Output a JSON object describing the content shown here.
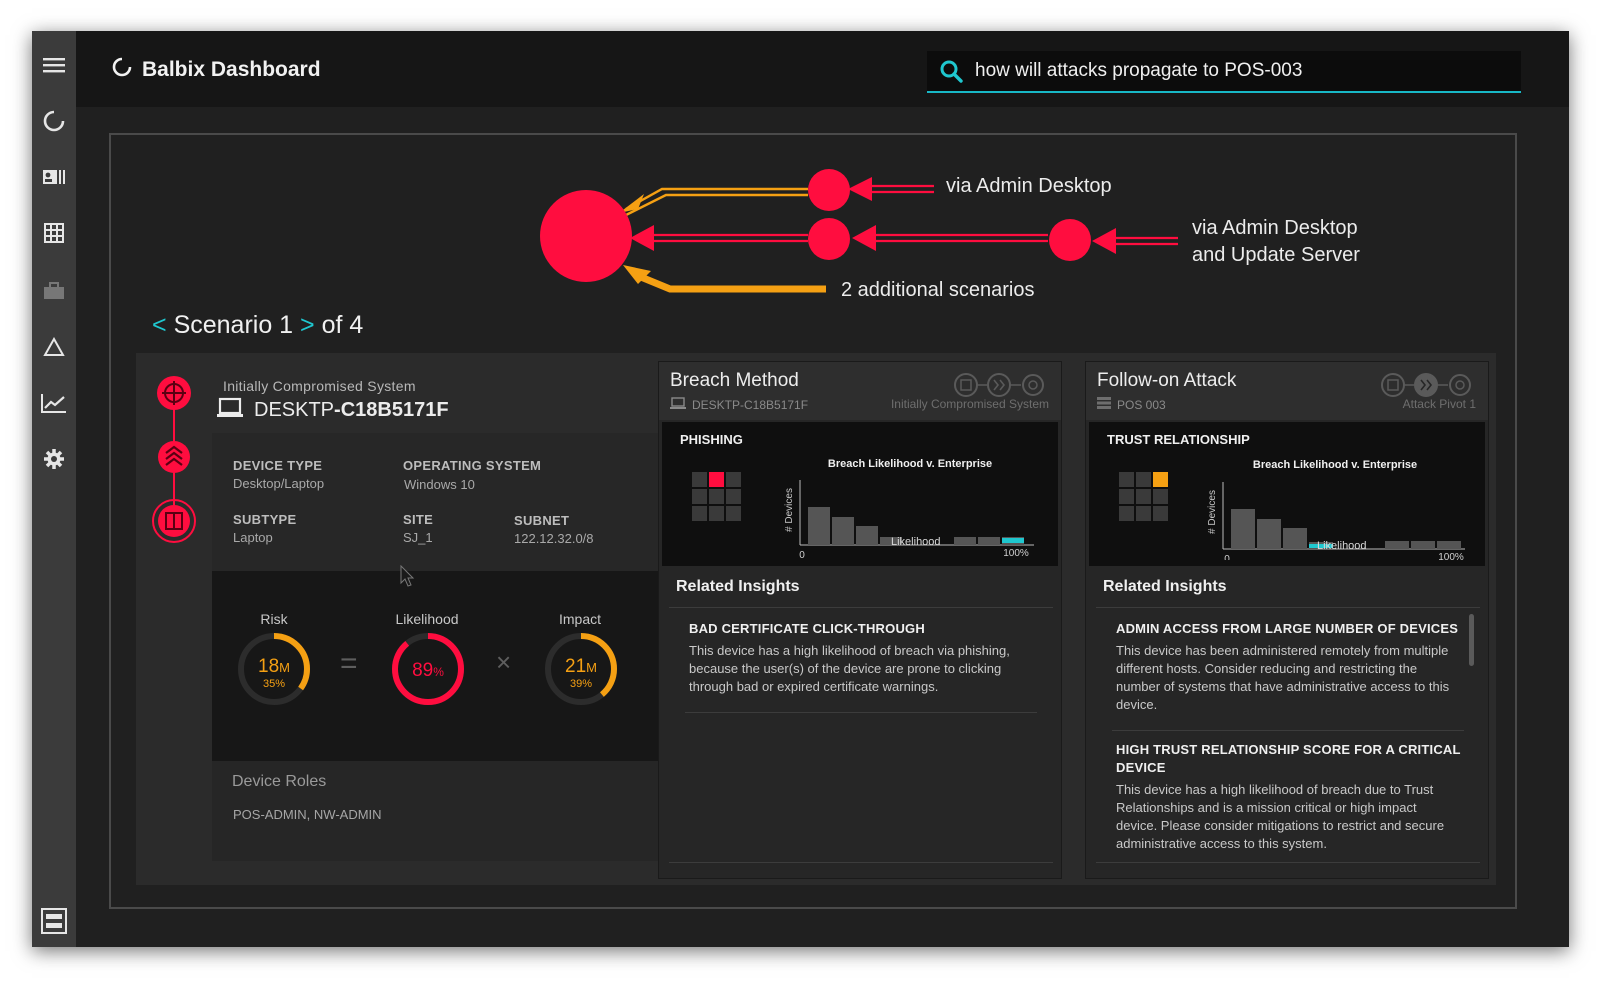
{
  "app": {
    "title": "Balbix Dashboard"
  },
  "search": {
    "value": "how will attacks propagate to POS-003"
  },
  "sidebar": {
    "icons": [
      "menu-icon",
      "loader-icon",
      "id-card-icon",
      "grid-icon",
      "briefcase-icon",
      "warning-triangle-icon",
      "trend-chart-icon",
      "gear-icon",
      "collapse-icon"
    ]
  },
  "graph": {
    "paths": [
      {
        "label": "via Admin Desktop"
      },
      {
        "label_line1": "via Admin Desktop",
        "label_line2": "and Update Server"
      },
      {
        "label": "2 additional scenarios"
      }
    ],
    "colors": {
      "node": "#ff0d3f",
      "orange": "#f5a013"
    }
  },
  "scenario": {
    "prev": "<",
    "label": "Scenario 1",
    "next": ">",
    "of": "of 4"
  },
  "device": {
    "header_label": "Initially Compromised System",
    "name_prefix": "DESKTP",
    "name_suffix": "-C18B5171F",
    "device_type_label": "DEVICE TYPE",
    "device_type": "Desktop/Laptop",
    "os_label": "OPERATING SYSTEM",
    "os": "Windows 10",
    "subtype_label": "SUBTYPE",
    "subtype": "Laptop",
    "site_label": "SITE",
    "site": "SJ_1",
    "subnet_label": "SUBNET",
    "subnet": "122.12.32.0/8"
  },
  "metrics": {
    "risk": {
      "label": "Risk",
      "value": "18",
      "unit": "M",
      "percent": "35",
      "pct_sign": "%",
      "fraction": 0.35
    },
    "equals": "=",
    "likelihood": {
      "label": "Likelihood",
      "value": "89",
      "pct_sign": "%",
      "fraction": 0.89
    },
    "times": "×",
    "impact": {
      "label": "Impact",
      "value": "21",
      "unit": "M",
      "percent": "39",
      "pct_sign": "%",
      "fraction": 0.39
    }
  },
  "roles": {
    "title": "Device Roles",
    "value": "POS-ADMIN, NW-ADMIN"
  },
  "breach_card": {
    "title": "Breach Method",
    "sub": "DESKTP-C18B5171F",
    "sub_right": "Initially Compromised System",
    "method": "PHISHING",
    "chart_title": "Breach Likelihood v. Enterprise",
    "y_label": "# Devices",
    "x_label": "Likelihood",
    "x_min": "0",
    "x_max": "100%",
    "insights_title": "Related Insights",
    "insights": [
      {
        "title": "BAD CERTIFICATE CLICK-THROUGH",
        "body": "This device has a high likelihood of breach via phishing, because the user(s) of the device are prone to clicking through bad or expired certificate warnings."
      }
    ]
  },
  "followon_card": {
    "title": "Follow-on Attack",
    "sub": "POS 003",
    "sub_right": "Attack  Pivot 1",
    "method": "TRUST RELATIONSHIP",
    "chart_title": "Breach Likelihood v. Enterprise",
    "y_label": "# Devices",
    "x_label": "Likelihood",
    "x_min": "0",
    "x_max": "100%",
    "insights_title": "Related Insights",
    "insights": [
      {
        "title": "ADMIN ACCESS FROM LARGE NUMBER OF DEVICES",
        "body": "This device has been administered remotely from multiple different hosts. Consider reducing and restricting the number of systems that have administrative access to this device."
      },
      {
        "title": "HIGH TRUST RELATIONSHIP SCORE FOR A CRITICAL DEVICE",
        "body": "This device has a high likelihood of breach due to Trust Relationships and is a mission critical or high impact device.  Please consider mitigations to restrict and secure administrative access to this system."
      }
    ]
  },
  "colors": {
    "accent": "#18b8c6",
    "red": "#ff0d3f",
    "orange": "#f5a013"
  }
}
